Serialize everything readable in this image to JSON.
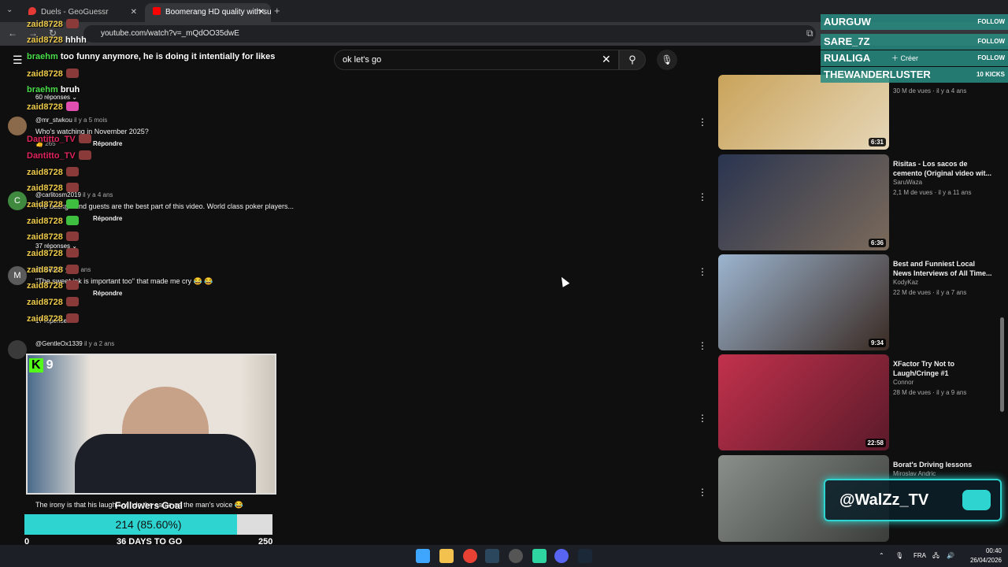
{
  "browser": {
    "tabs": [
      {
        "label": "Duels - GeoGuessr"
      },
      {
        "label": "Boomerang HD quality with su"
      }
    ],
    "url": "youtube.com/watch?v=_mQdOO35dwE"
  },
  "youtube": {
    "search_value": "ok let's go",
    "comments": [
      {
        "author": "@mr_stwkou",
        "age": "il y a 5 mois",
        "text": "Who's watching in November 2025?",
        "likes": "265",
        "reply": "Répondre",
        "avatar": ""
      },
      {
        "author": "@carlitosm2019",
        "age": "il y a 4 ans",
        "text": "The background guests are the best part of this video. World class poker players...",
        "likes": "",
        "reply": "Répondre",
        "avatar": "C"
      },
      {
        "author": "@userfk",
        "age": "il y a 3 ans",
        "text": "\"The sweet ink is important too\" that made me cry 😂 😂",
        "likes": "",
        "reply": "Répondre",
        "avatar": "M"
      },
      {
        "author": "@GentleOx1339",
        "age": "il y a 2 ans",
        "text": "",
        "likes": "",
        "reply": "",
        "avatar": ""
      },
      {
        "author": "",
        "age": "",
        "text": "The irony is that his laugh sounds the same as the man's voice 😂",
        "likes": "",
        "reply": "",
        "avatar": ""
      }
    ],
    "replies": [
      "60 réponses",
      "37 réponses",
      "17 réponses"
    ],
    "videos": [
      {
        "title": "",
        "channel": "",
        "meta": "30 M de vues · il y a 4 ans",
        "duration": "6:31",
        "thumb_color": "#c9a35a"
      },
      {
        "title": "Risitas - Los sacos de cemento (Original video wit...",
        "channel": "SaruWaza",
        "meta": "2,1 M de vues · il y a 11 ans",
        "duration": "6:36",
        "thumb_color": "#3b4a63"
      },
      {
        "title": "Best and Funniest Local News Interviews of All Time...",
        "channel": "KodyKaz",
        "meta": "22 M de vues · il y a 7 ans",
        "duration": "9:34",
        "thumb_color": "#6b8fb5"
      },
      {
        "title": "XFactor Try Not to Laugh/Cringe #1",
        "channel": "Connor",
        "meta": "28 M de vues · il y a 9 ans",
        "duration": "22:58",
        "thumb_color": "#c2314c"
      },
      {
        "title": "Borat's Driving lessons",
        "channel": "Miroslav Andric",
        "meta": "",
        "duration": "",
        "thumb_color": "#8a8f8a"
      }
    ]
  },
  "chat": [
    {
      "user": "zaid8728",
      "msg": ""
    },
    {
      "user": "zaid8728",
      "msg": "hhhh"
    },
    {
      "user": "braehm",
      "msg": "too funny anymore, he is doing it intentially for likes"
    },
    {
      "user": "zaid8728",
      "msg": ""
    },
    {
      "user": "braehm",
      "msg": "bruh"
    },
    {
      "user": "zaid8728",
      "msg": ""
    },
    {
      "user": "Dantitto_TV",
      "msg": ""
    },
    {
      "user": "Dantitto_TV",
      "msg": ""
    },
    {
      "user": "zaid8728",
      "msg": ""
    },
    {
      "user": "zaid8728",
      "msg": ""
    },
    {
      "user": "zaid8728",
      "msg": ""
    },
    {
      "user": "zaid8728",
      "msg": ""
    },
    {
      "user": "zaid8728",
      "msg": ""
    },
    {
      "user": "zaid8728",
      "msg": ""
    },
    {
      "user": "zaid8728",
      "msg": ""
    },
    {
      "user": "zaid8728",
      "msg": ""
    },
    {
      "user": "zaid8728",
      "msg": ""
    },
    {
      "user": "zaid8728",
      "msg": ""
    },
    {
      "user": "zaid8728",
      "msg": ""
    }
  ],
  "overlay": {
    "kick_viewers": "9",
    "goal_title": "Followers Goal",
    "goal_text": "214 (85.60%)",
    "goal_fraction": 0.856,
    "goal_min": "0",
    "goal_max": "250",
    "goal_days": "36 DAYS TO GO",
    "banner": "@WalZz_TV",
    "kick_names": [
      "AURGUW",
      "SARE_7Z",
      "RUALIGA",
      "THEWANDERLUSTER"
    ],
    "kick_tags": [
      "FOLLOW",
      "FOLLOW",
      "FOLLOW",
      "10 KICKS"
    ],
    "create_label": "Créer"
  },
  "taskbar": {
    "lang": "FRA",
    "time": "00:40",
    "date": "26/04/2026"
  }
}
